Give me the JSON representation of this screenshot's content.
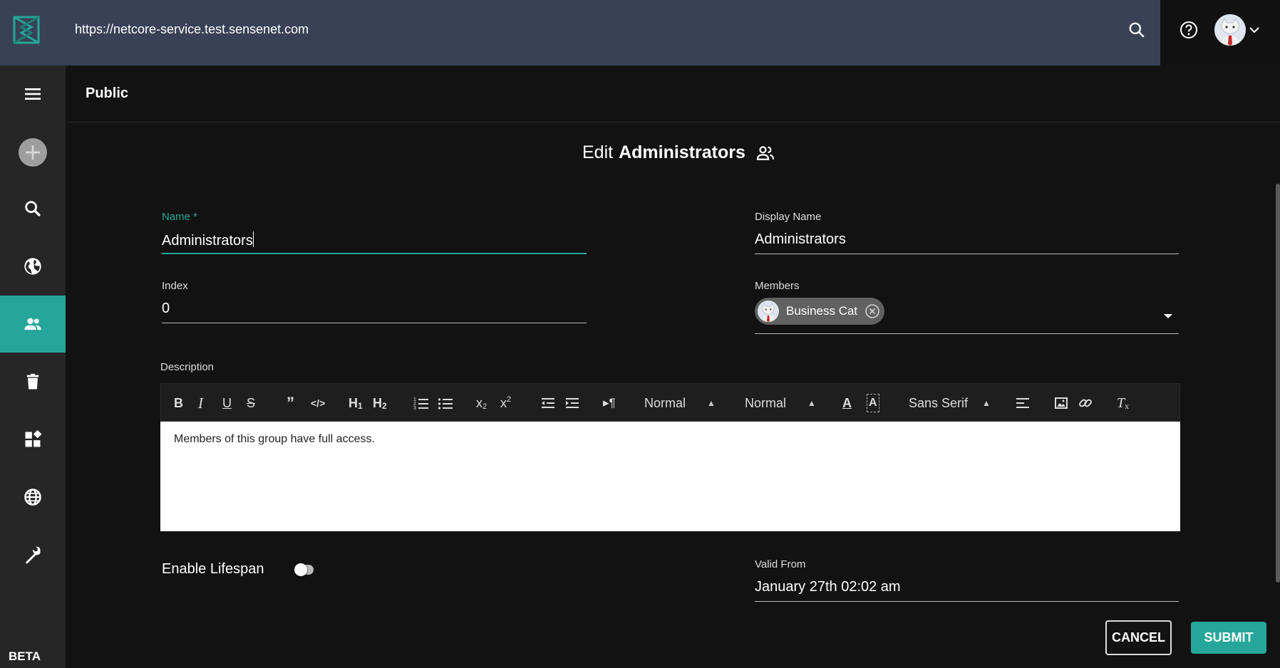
{
  "topbar": {
    "url": "https://netcore-service.test.sensenet.com",
    "icons": [
      "sensenet-logo",
      "search-icon",
      "help-icon",
      "avatar",
      "chevron-down-icon"
    ]
  },
  "sidebar": {
    "items": [
      {
        "icon": "menu-icon"
      },
      {
        "icon": "add-icon"
      },
      {
        "icon": "search-icon"
      },
      {
        "icon": "globe-icon"
      },
      {
        "icon": "users-icon",
        "active": true
      },
      {
        "icon": "trash-icon"
      },
      {
        "icon": "dashboard-icon"
      },
      {
        "icon": "language-icon"
      },
      {
        "icon": "wrench-icon"
      }
    ],
    "beta_label": "BETA"
  },
  "breadcrumb": {
    "title": "Public"
  },
  "form": {
    "title_prefix": "Edit",
    "title_name": "Administrators",
    "name": {
      "label": "Name *",
      "value": "Administrators"
    },
    "display_name": {
      "label": "Display Name",
      "value": "Administrators"
    },
    "index": {
      "label": "Index",
      "value": "0"
    },
    "members": {
      "label": "Members",
      "chips": [
        "Business Cat"
      ]
    },
    "description": {
      "label": "Description",
      "toolbar": {
        "header_select": "Normal",
        "size_select": "Normal",
        "font_select": "Sans Serif"
      },
      "text": "Members of this group have full access."
    },
    "lifespan": {
      "label": "Enable Lifespan",
      "enabled": false
    },
    "valid_from": {
      "label": "Valid From",
      "value": "January 27th 02:02 am"
    },
    "cancel_label": "CANCEL",
    "submit_label": "SUBMIT"
  },
  "colors": {
    "accent": "#26a69a",
    "topbar": "#384156",
    "sidebar": "#262626",
    "background": "#121212"
  }
}
